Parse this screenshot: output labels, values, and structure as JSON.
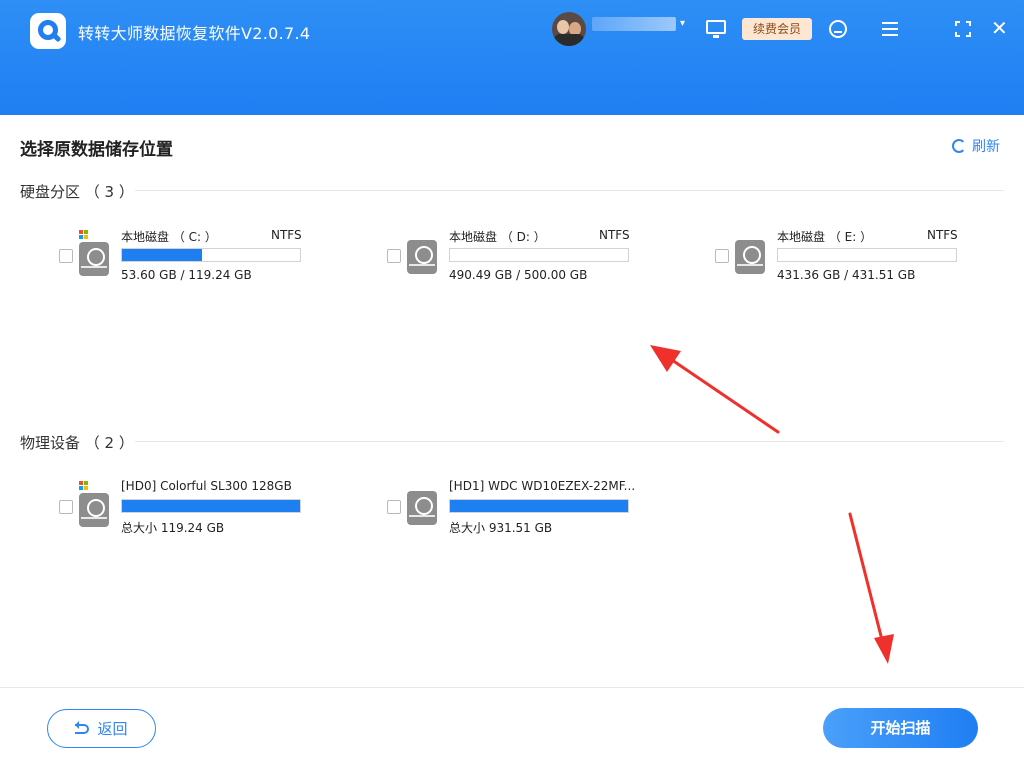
{
  "window": {
    "title": "转转大师数据恢复软件V2.0.7.4"
  },
  "toolbar": {
    "vip_label": "续费会员",
    "close_glyph": "✕",
    "caret_glyph": "▾"
  },
  "main": {
    "title": "选择原数据储存位置",
    "refresh_label": "刷新",
    "partitions": {
      "title": "硬盘分区 （ 3 ）",
      "items": [
        {
          "name": "本地磁盘 （ C: ）",
          "fs": "NTFS",
          "size": "53.60 GB / 119.24 GB",
          "used_fraction": 0.45,
          "os_drive": true
        },
        {
          "name": "本地磁盘 （ D: ）",
          "fs": "NTFS",
          "size": "490.49 GB / 500.00 GB",
          "used_fraction": 0.0,
          "os_drive": false
        },
        {
          "name": "本地磁盘 （ E: ）",
          "fs": "NTFS",
          "size": "431.36 GB / 431.51 GB",
          "used_fraction": 0.0,
          "os_drive": false
        }
      ]
    },
    "physical": {
      "title": "物理设备 （ 2 ）",
      "items": [
        {
          "name": "[HD0] Colorful SL300 128GB",
          "size": "总大小 119.24 GB",
          "used_fraction": 1.0,
          "os_drive": true
        },
        {
          "name": "[HD1] WDC WD10EZEX-22MF...",
          "size": "总大小 931.51 GB",
          "used_fraction": 1.0,
          "os_drive": false
        }
      ]
    }
  },
  "footer": {
    "back_label": "返回",
    "scan_label": "开始扫描"
  },
  "colors": {
    "accent": "#1f7ef2",
    "annotation": "#f0302b"
  }
}
